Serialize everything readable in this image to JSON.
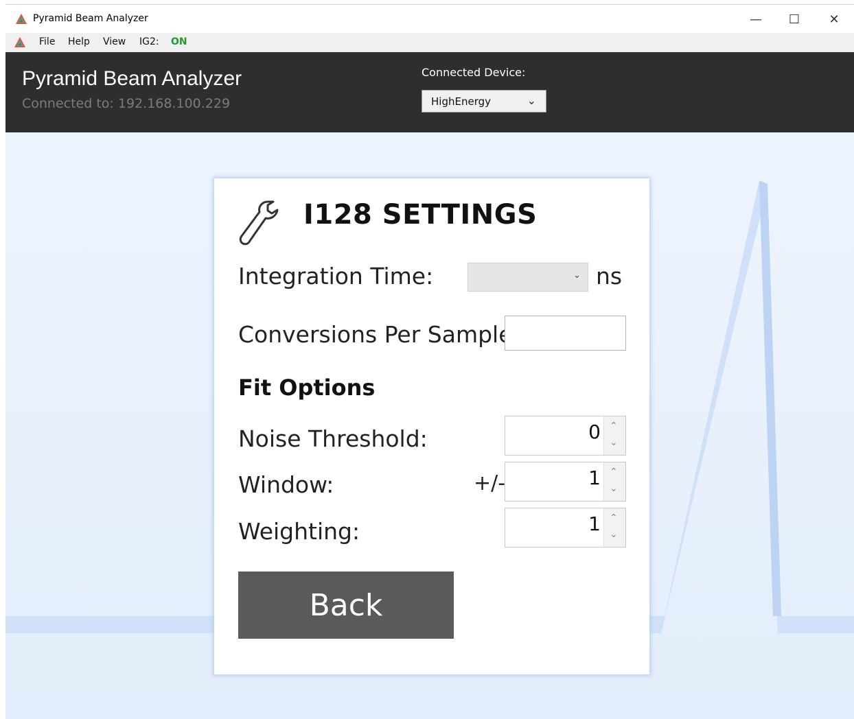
{
  "window": {
    "title": "Pyramid Beam Analyzer",
    "controls": {
      "minimize": "—",
      "maximize": "☐",
      "close": "✕"
    }
  },
  "menu": {
    "items": [
      "File",
      "Help",
      "View"
    ],
    "ig2_label": "IG2:",
    "ig2_status": "ON",
    "ig2_status_color": "#1e9d2e"
  },
  "header": {
    "app_name": "Pyramid Beam Analyzer",
    "connected_to": "Connected to: 192.168.100.229",
    "device_label": "Connected Device:",
    "device_value": "HighEnergy"
  },
  "settings": {
    "title": "I128 SETTINGS",
    "integration_time_label": "Integration Time:",
    "integration_time_value": "",
    "integration_time_unit": "ns",
    "conversions_label": "Conversions Per Sample:",
    "conversions_value": "",
    "fit_options_heading": "Fit Options",
    "noise_threshold_label": "Noise Threshold:",
    "noise_threshold_value": "0",
    "window_label": "Window:",
    "window_prefix": "+/-",
    "window_value": "1",
    "weighting_label": "Weighting:",
    "weighting_value": "1",
    "back_label": "Back"
  },
  "colors": {
    "header_bg": "#2e2e2e",
    "back_button": "#5a5a5a",
    "background": "#e8f0fc"
  }
}
